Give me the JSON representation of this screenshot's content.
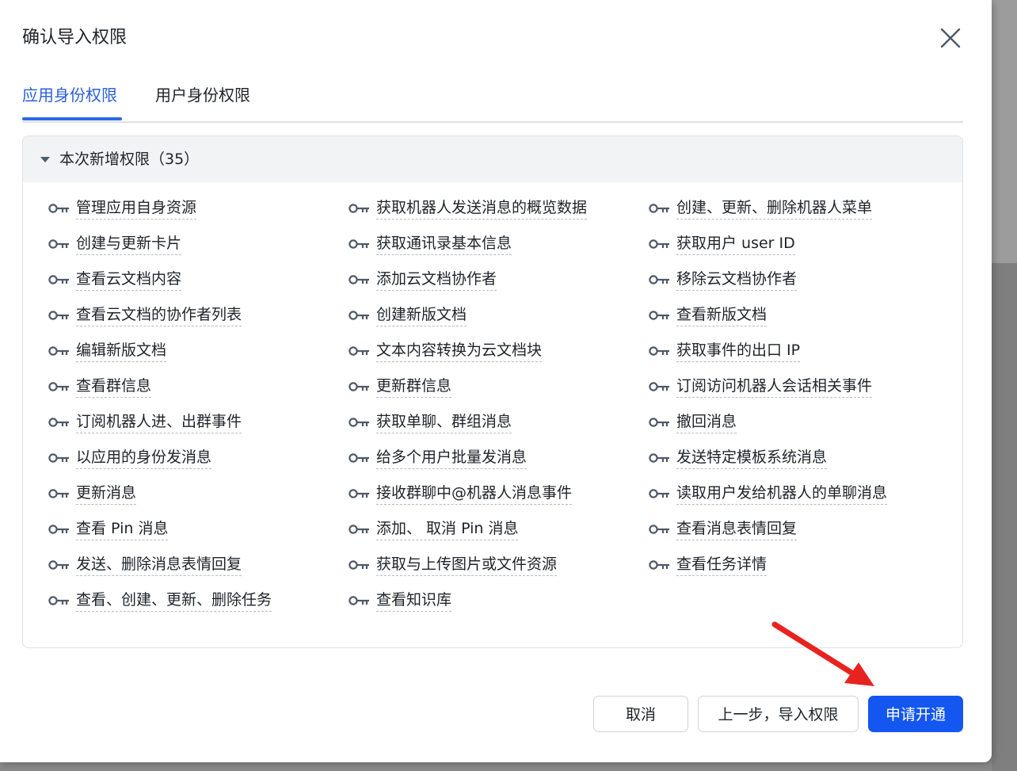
{
  "dialog": {
    "title": "确认导入权限",
    "close_icon": "close-icon"
  },
  "tabs": [
    {
      "label": "应用身份权限",
      "active": true
    },
    {
      "label": "用户身份权限",
      "active": false
    }
  ],
  "section": {
    "title": "本次新增权限（35）",
    "expanded": true
  },
  "permissions": [
    [
      "管理应用自身资源",
      "创建与更新卡片",
      "查看云文档内容",
      "查看云文档的协作者列表",
      "编辑新版文档",
      "查看群信息",
      "订阅机器人进、出群事件",
      "以应用的身份发消息",
      "更新消息",
      "查看 Pin 消息",
      "发送、删除消息表情回复",
      "查看、创建、更新、删除任务"
    ],
    [
      "获取机器人发送消息的概览数据",
      "获取通讯录基本信息",
      "添加云文档协作者",
      "创建新版文档",
      "文本内容转换为云文档块",
      "更新群信息",
      "获取单聊、群组消息",
      "给多个用户批量发消息",
      "接收群聊中@机器人消息事件",
      "添加、 取消 Pin 消息",
      "获取与上传图片或文件资源",
      "查看知识库"
    ],
    [
      "创建、更新、删除机器人菜单",
      "获取用户 user ID",
      "移除云文档协作者",
      "查看新版文档",
      "获取事件的出口 IP",
      "订阅访问机器人会话相关事件",
      "撤回消息",
      "发送特定模板系统消息",
      "读取用户发给机器人的单聊消息",
      "查看消息表情回复",
      "查看任务详情"
    ]
  ],
  "buttons": {
    "cancel": "取消",
    "back": "上一步，导入权限",
    "apply": "申请开通"
  },
  "colors": {
    "accent": "#1456f0",
    "tab_active": "#2a5fd6",
    "arrow": "#e8231f"
  }
}
